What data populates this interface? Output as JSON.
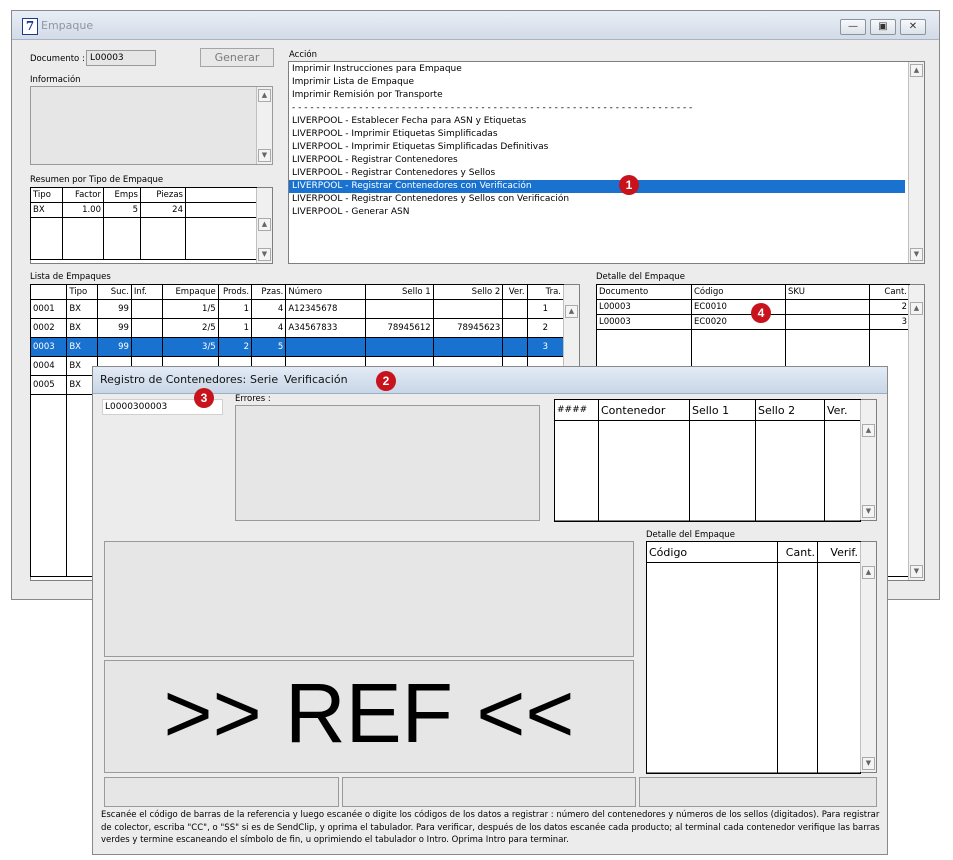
{
  "window": {
    "title": "Empaque",
    "icon_glyph": "7",
    "controls": [
      "minimize-icon",
      "restore-icon",
      "close-icon"
    ]
  },
  "documento": {
    "label": "Documento :",
    "value": "L00003"
  },
  "generar_label": "Generar",
  "informacion_label": "Información",
  "accion": {
    "label": "Acción",
    "items_top": [
      "Imprimir Instrucciones para Empaque",
      "Imprimir Lista de Empaque",
      "Imprimir Remisión por Transporte"
    ],
    "separator": "- - - - - - - - - - - - - - - - - - - - - - - - - - - - - - - - - - - - - - - - - - - - - - - - - - - - - - - - - - - - - - - - - -",
    "items_bottom": [
      "LIVERPOOL - Establecer Fecha para ASN y Etiquetas",
      "LIVERPOOL - Imprimir Etiquetas Simplificadas",
      "LIVERPOOL - Imprimir Etiquetas Simplificadas Definitivas",
      "LIVERPOOL - Registrar Contenedores",
      "LIVERPOOL - Registrar Contenedores y Sellos",
      "LIVERPOOL - Registrar Contenedores con Verificación",
      "LIVERPOOL - Registrar Contenedores y Sellos con Verificación",
      "LIVERPOOL - Generar ASN"
    ],
    "selected_index": 5
  },
  "resumen": {
    "label": "Resumen por Tipo de Empaque",
    "headers": [
      "Tipo",
      "Factor",
      "Emps",
      "Piezas"
    ],
    "rows": [
      [
        "BX",
        "1.00",
        "5",
        "24"
      ]
    ]
  },
  "lista": {
    "label": "Lista de Empaques",
    "headers": [
      "",
      "Tipo",
      "Suc.",
      "Inf.",
      "Empaque",
      "Prods.",
      "Pzas.",
      "Número",
      "Sello 1",
      "Sello 2",
      "Ver.",
      "Tra."
    ],
    "rows": [
      [
        "0001",
        "BX",
        "99",
        "",
        "1/5",
        "1",
        "4",
        "A12345678",
        "",
        "",
        "",
        "1"
      ],
      [
        "0002",
        "BX",
        "99",
        "",
        "2/5",
        "1",
        "4",
        "A34567833",
        "78945612",
        "78945623",
        "",
        "2"
      ],
      [
        "0003",
        "BX",
        "99",
        "",
        "3/5",
        "2",
        "5",
        "",
        "",
        "",
        "",
        "3"
      ],
      [
        "0004",
        "BX",
        "",
        "",
        "",
        "",
        "",
        "",
        "",
        "",
        "",
        ""
      ],
      [
        "0005",
        "BX",
        "",
        "",
        "",
        "",
        "",
        "",
        "",
        "",
        "",
        ""
      ]
    ],
    "selected_row": 2
  },
  "detalle": {
    "label": "Detalle del Empaque",
    "headers": [
      "Documento",
      "Código",
      "SKU",
      "Cant."
    ],
    "rows": [
      [
        "L00003",
        "EC0010",
        "",
        "2"
      ],
      [
        "L00003",
        "EC0020",
        "",
        "3"
      ]
    ]
  },
  "dialog": {
    "title_parts": [
      "Registro de Contenedores:",
      "Serie",
      "Verificación"
    ],
    "input_value": "L0000300003",
    "errores_label": "Errores :",
    "cont_headers": [
      "####",
      "Contenedor",
      "Sello 1",
      "Sello 2",
      "Ver."
    ],
    "detalle_label": "Detalle del Empaque",
    "detalle_headers": [
      "Código",
      "Cant.",
      "Verif."
    ],
    "big_text": ">> REF <<",
    "help_text": "Escanée el código de barras de la referencia y luego escanée o digite los códigos de los datos a registrar : número del contenedores y números de los sellos (digitados). Para registrar de colector, escriba \"CC\", o \"SS\" si es de SendClip, y oprima el tabulador. Para verificar, después de los datos escanée cada producto; al terminal cada contenedor verifique las barras verdes y termine escaneando el símbolo de fin, u oprimiendo el tabulador o Intro. Oprima Intro para terminar."
  },
  "badges": [
    "1",
    "2",
    "3",
    "4"
  ],
  "colors": {
    "selection": "#1a72d0",
    "badge": "#c8121c"
  }
}
